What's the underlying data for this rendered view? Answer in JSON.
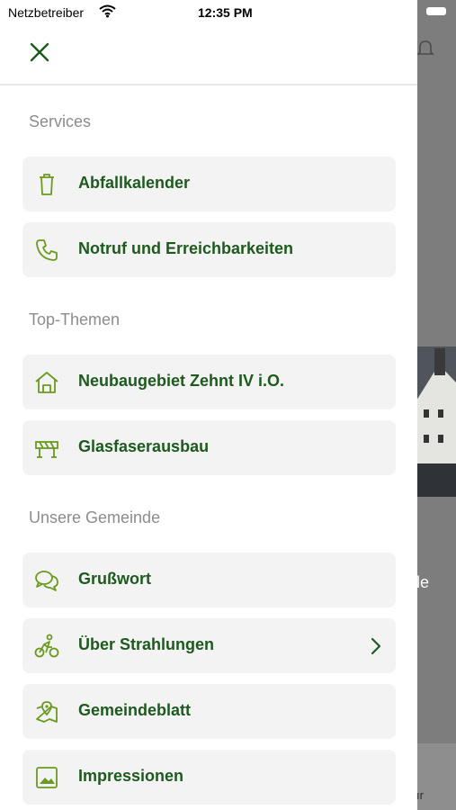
{
  "status_bar": {
    "carrier": "Netzbetreiber",
    "time": "12:35 PM"
  },
  "colors": {
    "accent": "#1d5a1d",
    "icon": "#6a9a1e",
    "section": "#8c8c8c",
    "item_bg": "#f3f3f3"
  },
  "sections": [
    {
      "title": "Services",
      "items": [
        {
          "label": "Abfallkalender",
          "icon": "trash-icon"
        },
        {
          "label": "Notruf und Erreichbarkeiten",
          "icon": "phone-icon"
        }
      ]
    },
    {
      "title": "Top-Themen",
      "items": [
        {
          "label": "Neubaugebiet Zehnt IV i.O.",
          "icon": "house-icon"
        },
        {
          "label": "Glasfaserausbau",
          "icon": "barrier-icon"
        }
      ]
    },
    {
      "title": "Unsere Gemeinde",
      "items": [
        {
          "label": "Grußwort",
          "icon": "chat-icon"
        },
        {
          "label": "Über Strahlungen",
          "icon": "cyclist-icon",
          "has_submenu": true
        },
        {
          "label": "Gemeindeblatt",
          "icon": "map-pin-icon"
        },
        {
          "label": "Impressionen",
          "icon": "image-icon"
        }
      ]
    }
  ],
  "background": {
    "text_fragment_1": "le",
    "text_fragment_2": "ır"
  }
}
